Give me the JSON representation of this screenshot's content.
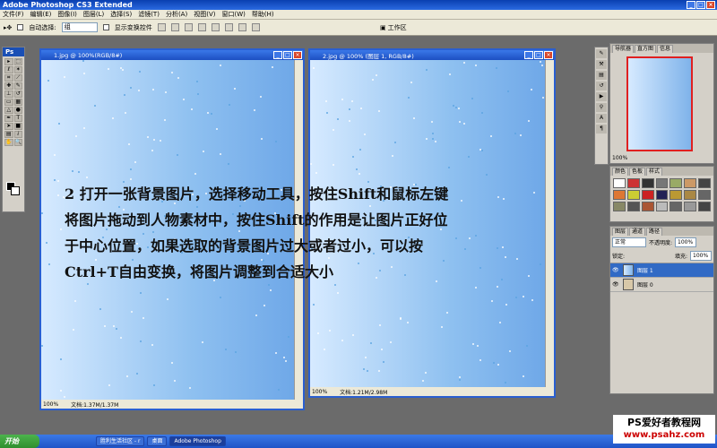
{
  "app_title": "Adobe Photoshop CS3 Extended",
  "menu": [
    "文件(F)",
    "编辑(E)",
    "图像(I)",
    "图层(L)",
    "选择(S)",
    "滤镜(T)",
    "分析(A)",
    "视图(V)",
    "窗口(W)",
    "帮助(H)"
  ],
  "options": {
    "auto_select": "自动选择:",
    "auto_select_value": "组",
    "show_transform": "显示变换控件",
    "workspace": "工作区"
  },
  "doc1": {
    "title": "1.jpg @ 100%(RGB/8#)",
    "zoom": "100%",
    "status": "文档:1.37M/1.37M"
  },
  "doc2": {
    "title": "2.jpg @ 100% (图层 1, RGB/8#)",
    "zoom": "100%",
    "status": "文档:1.21M/2.98M"
  },
  "navigator": {
    "tabs": [
      "导航器",
      "直方图",
      "信息"
    ],
    "zoom": "100%"
  },
  "swatches": {
    "tabs": [
      "颜色",
      "色板",
      "样式"
    ]
  },
  "layers": {
    "tabs": [
      "图层",
      "通道",
      "路径"
    ],
    "blend_mode": "正常",
    "opacity_label": "不透明度:",
    "opacity": "100%",
    "lock_label": "锁定:",
    "fill_label": "填充:",
    "fill": "100%",
    "items": [
      "图层 1",
      "图层 0"
    ]
  },
  "overlay_text": [
    "2 打开一张背景图片，选择移动工具，按住Shift和鼠标左键",
    "将图片拖动到人物素材中，按住Shift的作用是让图片正好位",
    "于中心位置，如果选取的背景图片过大或者过小，可以按",
    "Ctrl+T自由变换，将图片调整到合适大小"
  ],
  "taskbar": {
    "start": "开始",
    "buttons": [
      "胜利生活社区 - r",
      "桌面",
      "Adobe Photoshop"
    ]
  },
  "watermark": {
    "line1": "PS爱好者教程网",
    "line2": "www.psahz.com"
  }
}
